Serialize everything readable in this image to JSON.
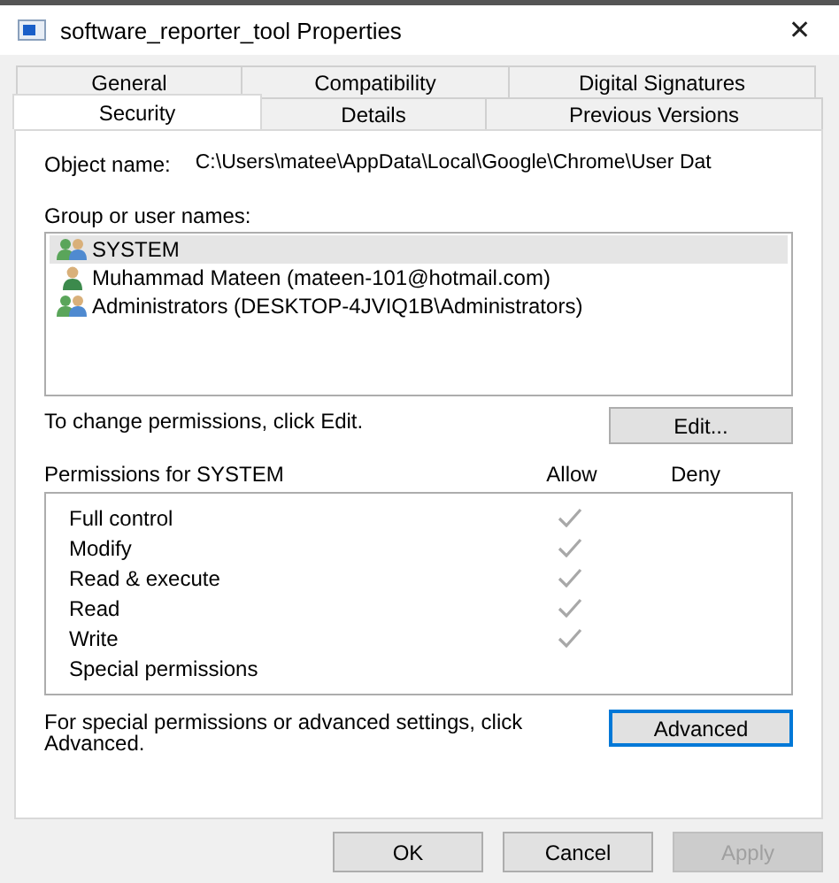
{
  "window": {
    "title": "software_reporter_tool Properties",
    "close": "✕"
  },
  "tabs": [
    [
      {
        "label": "General",
        "selected": false
      },
      {
        "label": "Compatibility",
        "selected": false
      },
      {
        "label": "Digital Signatures",
        "selected": false
      }
    ],
    [
      {
        "label": "Security",
        "selected": true
      },
      {
        "label": "Details",
        "selected": false
      },
      {
        "label": "Previous Versions",
        "selected": false
      }
    ]
  ],
  "object_name": {
    "label": "Object name:",
    "value": "C:\\Users\\matee\\AppData\\Local\\Google\\Chrome\\User Dat"
  },
  "users": {
    "label": "Group or user names:",
    "items": [
      {
        "kind": "group",
        "name": "SYSTEM",
        "selected": true
      },
      {
        "kind": "user",
        "name": "Muhammad Mateen (mateen-101@hotmail.com)",
        "selected": false
      },
      {
        "kind": "group",
        "name": "Administrators (DESKTOP-4JVIQ1B\\Administrators)",
        "selected": false
      }
    ]
  },
  "edit_hint": "To change permissions, click Edit.",
  "edit_button": {
    "label": "Edit...",
    "default": false
  },
  "permissions": {
    "label": "Permissions for SYSTEM",
    "allow_header": "Allow",
    "deny_header": "Deny",
    "items": [
      {
        "name": "Full control",
        "allow": true,
        "deny": false
      },
      {
        "name": "Modify",
        "allow": true,
        "deny": false
      },
      {
        "name": "Read & execute",
        "allow": true,
        "deny": false
      },
      {
        "name": "Read",
        "allow": true,
        "deny": false
      },
      {
        "name": "Write",
        "allow": true,
        "deny": false
      },
      {
        "name": "Special permissions",
        "allow": false,
        "deny": false
      }
    ]
  },
  "advanced_hint": "For special permissions or advanced settings, click Advanced.",
  "advanced_button": {
    "label": "Advanced",
    "default": true
  },
  "buttons": [
    {
      "label": "OK",
      "disabled": false
    },
    {
      "label": "Cancel",
      "disabled": false
    },
    {
      "label": "Apply",
      "disabled": true
    }
  ]
}
